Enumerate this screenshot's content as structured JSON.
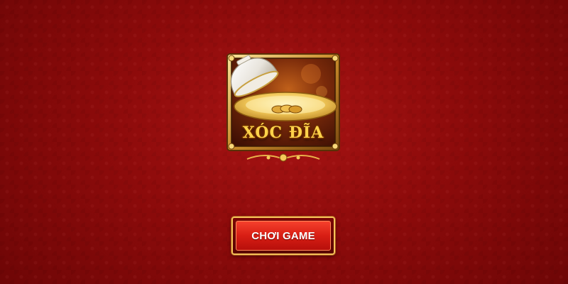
{
  "game": {
    "logo_title": "XÓC ĐĨA",
    "logo_icon": "bowl-and-plate-icon"
  },
  "actions": {
    "play_label": "CHƠI GAME"
  },
  "colors": {
    "background": "#8e0b0b",
    "button_red": "#d81e14",
    "gold": "#f6c15a"
  }
}
